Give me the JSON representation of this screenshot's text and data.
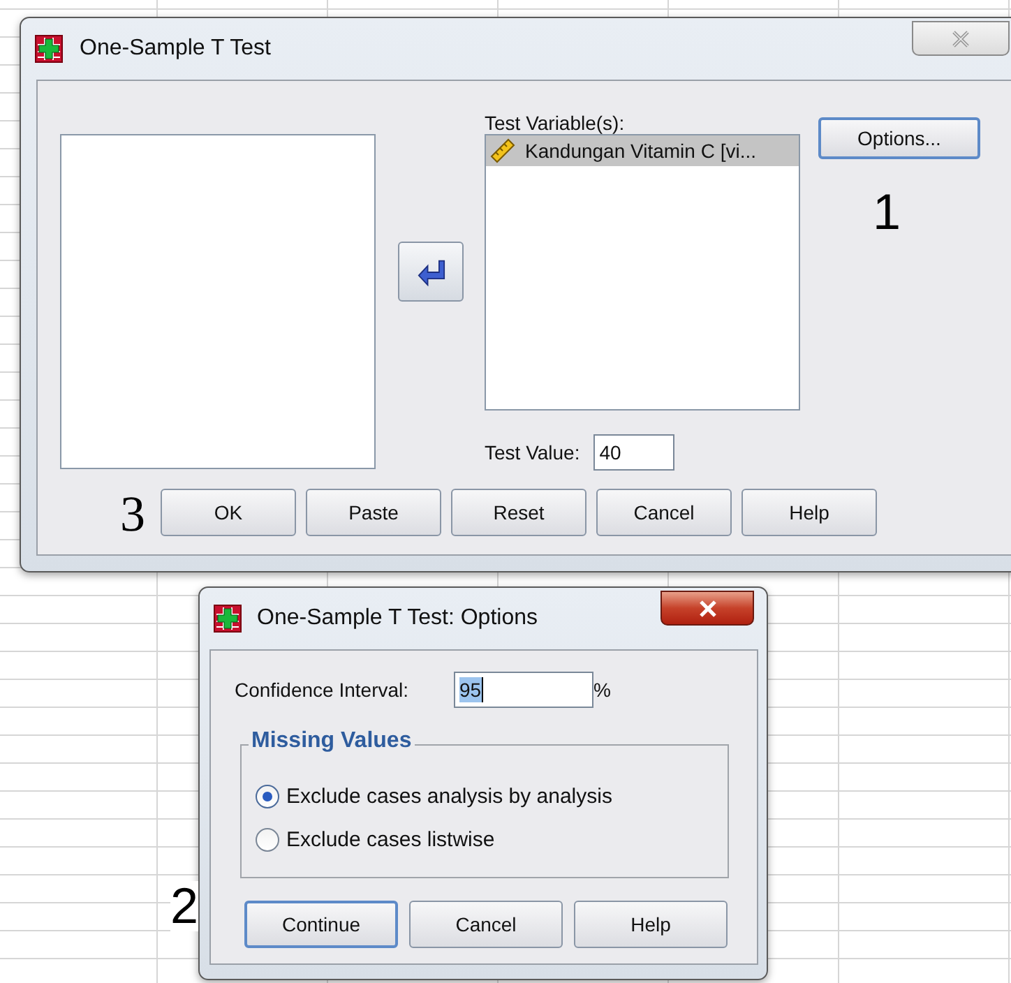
{
  "main_dialog": {
    "title": "One-Sample T Test",
    "test_variables": {
      "label": "Test Variable(s):",
      "items": [
        {
          "text": "Kandungan Vitamin C [vi...",
          "selected": true
        }
      ]
    },
    "options_button": "Options...",
    "test_value": {
      "label": "Test Value:",
      "value": "40"
    },
    "buttons": [
      "OK",
      "Paste",
      "Reset",
      "Cancel",
      "Help"
    ]
  },
  "options_dialog": {
    "title": "One-Sample T Test: Options",
    "confidence": {
      "label": "Confidence Interval:",
      "value": "95",
      "unit": "%"
    },
    "missing_values": {
      "legend": "Missing Values",
      "options": [
        {
          "label": "Exclude cases analysis by analysis",
          "selected": true
        },
        {
          "label": "Exclude cases listwise",
          "selected": false
        }
      ]
    },
    "buttons": [
      {
        "label": "Continue",
        "default": true
      },
      {
        "label": "Cancel",
        "default": false
      },
      {
        "label": "Help",
        "default": false
      }
    ]
  },
  "annotations": [
    {
      "text": "1"
    },
    {
      "text": "3"
    },
    {
      "text": "2"
    }
  ]
}
